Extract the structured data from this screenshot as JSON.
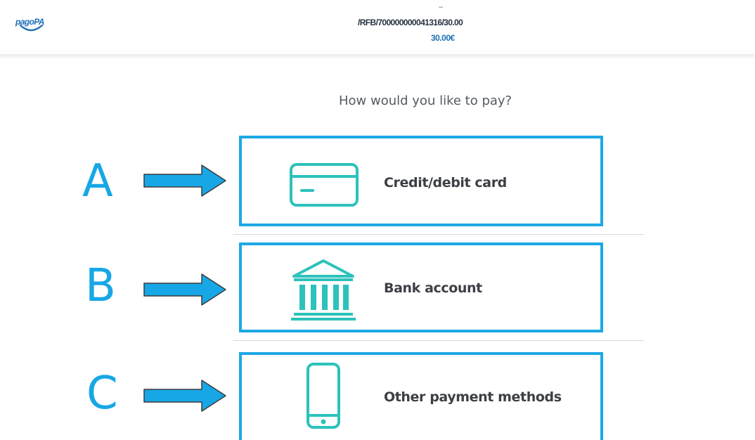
{
  "header": {
    "logo_text": "pagoPA",
    "dash": "–",
    "notice_code": "/RFB/700000000041316/30.00",
    "amount": "30.00€"
  },
  "main": {
    "question": "How would you like to pay?",
    "options": [
      {
        "label": "Credit/debit card",
        "icon": "credit-card-icon"
      },
      {
        "label": "Bank account",
        "icon": "bank-icon"
      },
      {
        "label": "Other payment methods",
        "icon": "smartphone-icon"
      }
    ]
  },
  "annotations": {
    "letters": [
      "A",
      "B",
      "C"
    ],
    "arrow_icon": "right-arrow-icon"
  },
  "colors": {
    "highlight": "#1da8e6",
    "icon": "#2cc2bb",
    "amount": "#1e6fb5",
    "label_text": "#3c3f44",
    "annotation": "#17a7e6"
  }
}
